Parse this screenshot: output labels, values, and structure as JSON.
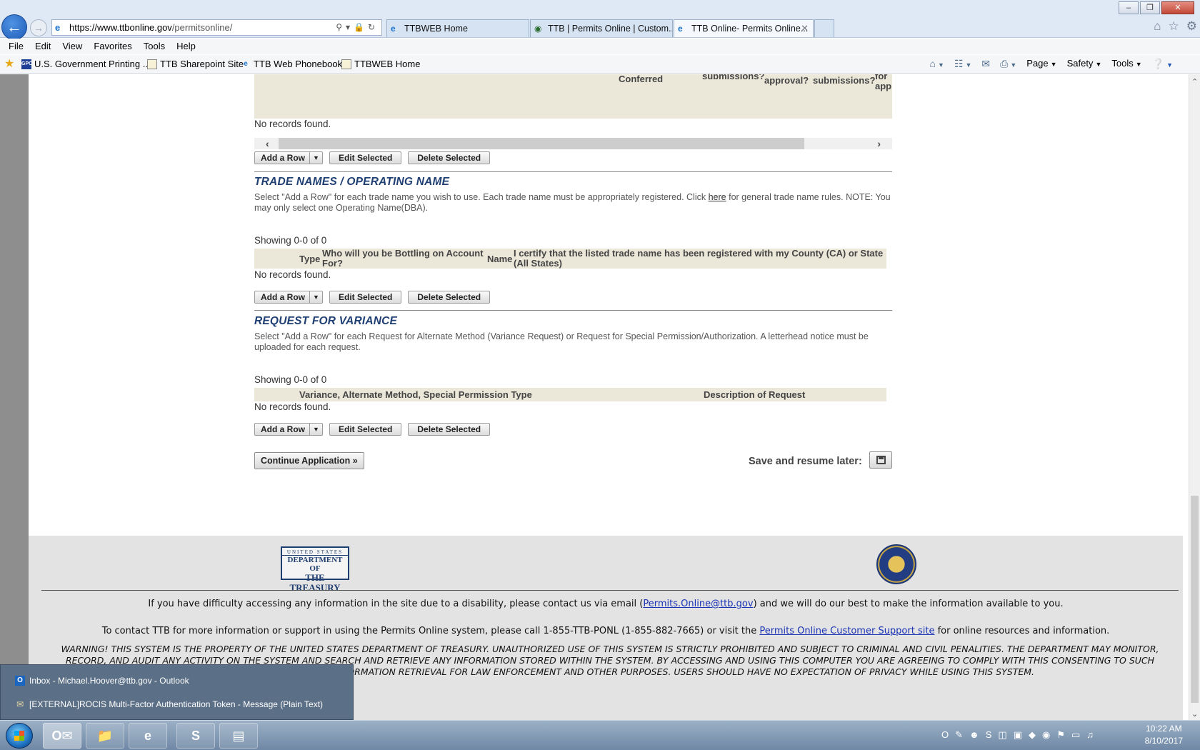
{
  "browser": {
    "url_host": "https://www.ttbonline.gov",
    "url_path": "/permitsonline/",
    "tabs": [
      {
        "label": "TTBWEB Home"
      },
      {
        "label": "TTB | Permits Online | Custom..."
      },
      {
        "label": "TTB Online- Permits Online..."
      }
    ],
    "menu": [
      "File",
      "Edit",
      "View",
      "Favorites",
      "Tools",
      "Help"
    ],
    "favorites": [
      {
        "label": "U.S. Government Printing ...",
        "icon": "gpo-icon"
      },
      {
        "label": "TTB Sharepoint Site",
        "icon": "doc-icon"
      },
      {
        "label": "TTB Web Phonebook",
        "icon": "ie-icon"
      },
      {
        "label": "TTBWEB Home",
        "icon": "doc-icon"
      }
    ],
    "command_bar": {
      "page": "Page",
      "safety": "Safety",
      "tools": "Tools"
    }
  },
  "upper_grid": {
    "headers": {
      "conferred": "Conferred",
      "submissions_1": "submissions?",
      "approval": "approval?",
      "submissions_2": "submissions?",
      "for_app": "for app"
    },
    "empty_text": "No records found."
  },
  "buttons": {
    "add_row": "Add a Row",
    "edit_selected": "Edit Selected",
    "delete_selected": "Delete Selected"
  },
  "trade_names": {
    "title": "TRADE NAMES / OPERATING NAME",
    "desc_before": "Select \"Add a Row\" for each trade name you wish to use. Each trade name must be appropriately registered. Click ",
    "desc_link": "here",
    "desc_after": " for general trade name rules. NOTE: You may only select one Operating Name(DBA).",
    "showing": "Showing 0-0 of 0",
    "columns": {
      "type": "Type",
      "bottling": "Who will you be Bottling on Account For?",
      "name": "Name",
      "certify": "I certify that the listed trade name has been registered with my County (CA) or State (All States)"
    },
    "empty_text": "No records found."
  },
  "variance": {
    "title": "REQUEST FOR VARIANCE",
    "desc": "Select \"Add a Row\" for each Request for Alternate Method (Variance Request) or Request for Special Permission/Authorization. A letterhead notice must be uploaded for each request.",
    "showing": "Showing 0-0 of 0",
    "columns": {
      "type": "Variance, Alternate Method, Special Permission Type",
      "description": "Description of Request"
    },
    "empty_text": "No records found."
  },
  "actions": {
    "continue": "Continue Application »",
    "save_label": "Save and resume later:"
  },
  "footer": {
    "logo": {
      "line1": "UNITED STATES",
      "line2": "DEPARTMENT OF",
      "line3": "THE TREASURY"
    },
    "accessibility_before": "If you have difficulty accessing any information in the site due to a disability, please contact us via email (",
    "accessibility_email": "Permits.Online@ttb.gov",
    "accessibility_after": ") and we will do our best to make the information available to you.",
    "contact_before": "To contact TTB for more information or support in using the Permits Online system, please call 1-855-TTB-PONL (1-855-882-7665) or visit the ",
    "contact_link": "Permits Online Customer Support site",
    "contact_after": " for online resources and information.",
    "warning": "WARNING! THIS SYSTEM IS THE PROPERTY OF THE UNITED STATES DEPARTMENT OF TREASURY. UNAUTHORIZED USE OF THIS SYSTEM IS STRICTLY PROHIBITED AND SUBJECT TO CRIMINAL AND CIVIL PENALITIES. THE DEPARTMENT MAY MONITOR, RECORD, AND AUDIT ANY ACTIVITY ON THE SYSTEM AND SEARCH AND RETRIEVE ANY INFORMATION STORED WITHIN THE SYSTEM. BY ACCESSING AND USING THIS COMPUTER YOU ARE AGREEING TO COMPLY WITH THIS CONSENTING TO SUCH MONITORING, RECORDING, AND INFORMATION RETRIEVAL FOR LAW ENFORCEMENT AND OTHER PURPOSES. USERS SHOULD HAVE NO EXPECTATION OF PRIVACY WHILE USING THIS SYSTEM."
  },
  "popup": {
    "item1": "Inbox - Michael.Hoover@ttb.gov - Outlook",
    "item2": "[EXTERNAL]ROCIS Multi-Factor Authentication Token - Message (Plain Text)"
  },
  "taskbar": {
    "time": "10:22 AM",
    "date": "8/10/2017"
  }
}
